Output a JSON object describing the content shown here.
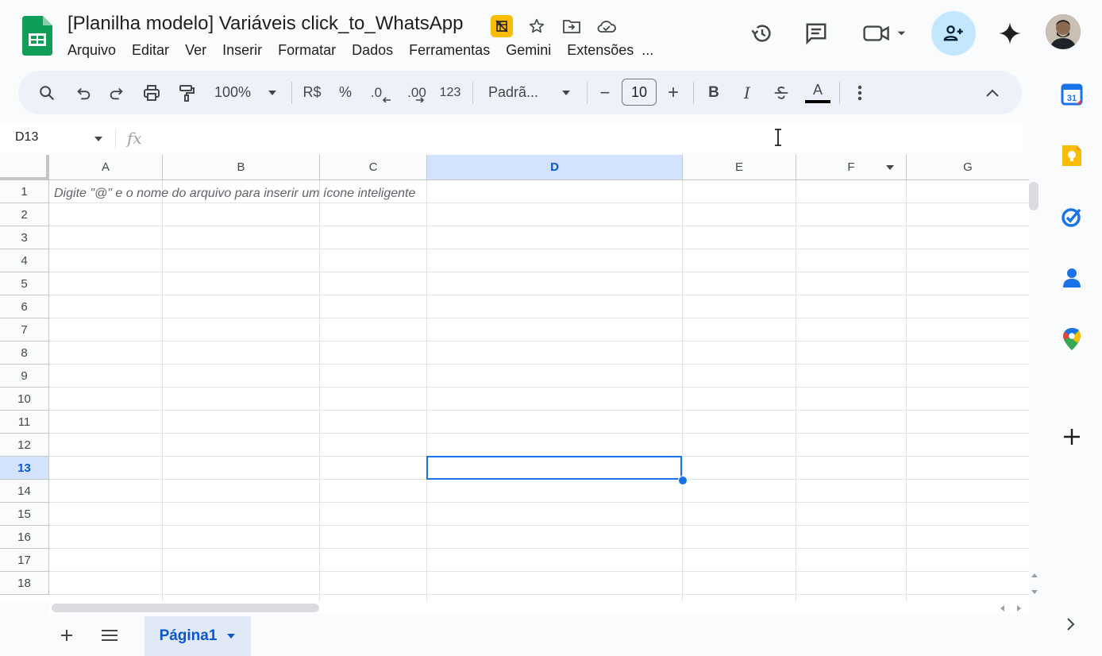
{
  "header": {
    "title": "[Planilha modelo] Variáveis click_to_WhatsApp",
    "menu": [
      "Arquivo",
      "Editar",
      "Ver",
      "Inserir",
      "Formatar",
      "Dados",
      "Ferramentas",
      "Gemini",
      "Extensões",
      "..."
    ],
    "icons": [
      "sheets-logo-icon",
      "no-offline-badge-icon",
      "star-icon",
      "move-folder-icon",
      "cloud-saved-icon",
      "history-icon",
      "comments-icon",
      "meet-video-icon",
      "share-add-person-icon",
      "gemini-sparkle-icon",
      "avatar"
    ]
  },
  "toolbar": {
    "zoom": "100%",
    "currency": "R$",
    "percent": "%",
    "decimal_decrease": ".0",
    "decimal_increase": ".00",
    "number_format": "123",
    "font": "Padrã...",
    "font_size": "10",
    "minus": "−",
    "plus": "+",
    "bold": "B",
    "italic": "I",
    "text_color_letter": "A"
  },
  "formula_bar": {
    "name_box": "D13",
    "fx": "fx"
  },
  "grid": {
    "columns": [
      "A",
      "B",
      "C",
      "D",
      "E",
      "F",
      "G"
    ],
    "selected_column": "D",
    "rows": [
      "1",
      "2",
      "3",
      "4",
      "5",
      "6",
      "7",
      "8",
      "9",
      "10",
      "11",
      "12",
      "13",
      "14",
      "15",
      "16",
      "17",
      "18"
    ],
    "selected_row": "13",
    "a1_hint": "Digite \"@\" e o nome do arquivo para inserir um ícone inteligente"
  },
  "sheets": {
    "active": "Página1"
  },
  "colors": {
    "accent": "#0b57d0",
    "selection": "#1a73e8",
    "share_bg": "#c2e7ff",
    "sheets_green": "#0f9d58"
  }
}
